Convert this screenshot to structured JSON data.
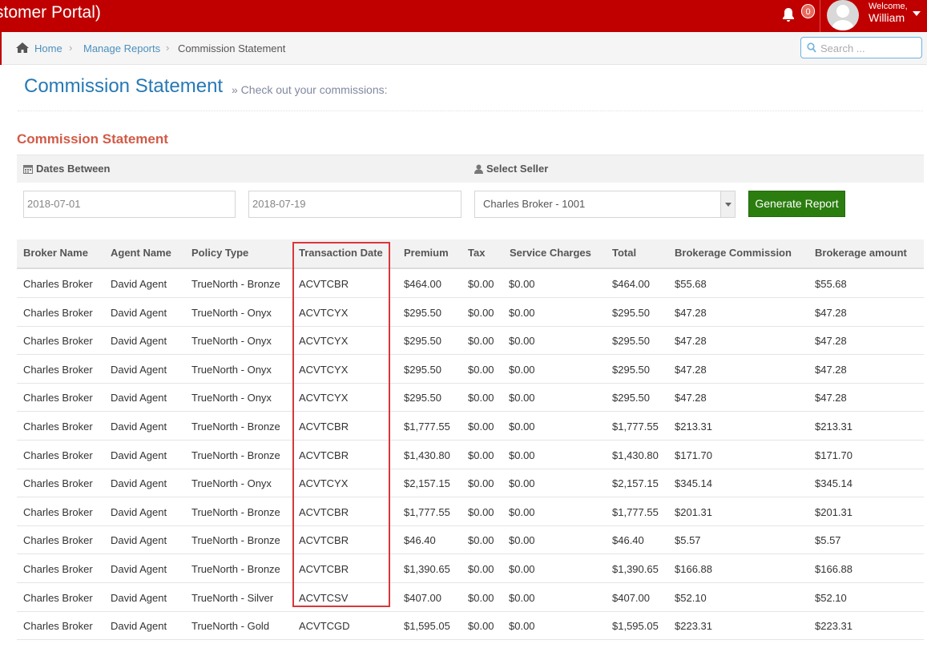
{
  "app": {
    "title": "stomer Portal)"
  },
  "header": {
    "notification_count": "0",
    "welcome": "Welcome,",
    "user_name": "William"
  },
  "breadcrumb": {
    "home": "Home",
    "manage_reports": "Manage Reports",
    "current": "Commission Statement"
  },
  "search": {
    "placeholder": "Search ..."
  },
  "page": {
    "title": "Commission Statement",
    "subtitle": "» Check out your commissions:"
  },
  "section": {
    "title": "Commission Statement"
  },
  "filters": {
    "dates_label": "Dates Between",
    "seller_label": "Select Seller",
    "date_from": "2018-07-01",
    "date_to": "2018-07-19",
    "seller_selected": "Charles Broker - 1001",
    "generate_label": "Generate Report"
  },
  "table": {
    "columns": [
      "Broker Name",
      "Agent Name",
      "Policy Type",
      "Transaction Date",
      "Premium",
      "Tax",
      "Service Charges",
      "Total",
      "Brokerage Commission",
      "Brokerage amount"
    ],
    "rows": [
      [
        "Charles Broker",
        "David Agent",
        "TrueNorth - Bronze",
        "ACVTCBR",
        "$464.00",
        "$0.00",
        "$0.00",
        "$464.00",
        "$55.68",
        "$55.68"
      ],
      [
        "Charles Broker",
        "David Agent",
        "TrueNorth - Onyx",
        "ACVTCYX",
        "$295.50",
        "$0.00",
        "$0.00",
        "$295.50",
        "$47.28",
        "$47.28"
      ],
      [
        "Charles Broker",
        "David Agent",
        "TrueNorth - Onyx",
        "ACVTCYX",
        "$295.50",
        "$0.00",
        "$0.00",
        "$295.50",
        "$47.28",
        "$47.28"
      ],
      [
        "Charles Broker",
        "David Agent",
        "TrueNorth - Onyx",
        "ACVTCYX",
        "$295.50",
        "$0.00",
        "$0.00",
        "$295.50",
        "$47.28",
        "$47.28"
      ],
      [
        "Charles Broker",
        "David Agent",
        "TrueNorth - Onyx",
        "ACVTCYX",
        "$295.50",
        "$0.00",
        "$0.00",
        "$295.50",
        "$47.28",
        "$47.28"
      ],
      [
        "Charles Broker",
        "David Agent",
        "TrueNorth - Bronze",
        "ACVTCBR",
        "$1,777.55",
        "$0.00",
        "$0.00",
        "$1,777.55",
        "$213.31",
        "$213.31"
      ],
      [
        "Charles Broker",
        "David Agent",
        "TrueNorth - Bronze",
        "ACVTCBR",
        "$1,430.80",
        "$0.00",
        "$0.00",
        "$1,430.80",
        "$171.70",
        "$171.70"
      ],
      [
        "Charles Broker",
        "David Agent",
        "TrueNorth - Onyx",
        "ACVTCYX",
        "$2,157.15",
        "$0.00",
        "$0.00",
        "$2,157.15",
        "$345.14",
        "$345.14"
      ],
      [
        "Charles Broker",
        "David Agent",
        "TrueNorth - Bronze",
        "ACVTCBR",
        "$1,777.55",
        "$0.00",
        "$0.00",
        "$1,777.55",
        "$201.31",
        "$201.31"
      ],
      [
        "Charles Broker",
        "David Agent",
        "TrueNorth - Bronze",
        "ACVTCBR",
        "$46.40",
        "$0.00",
        "$0.00",
        "$46.40",
        "$5.57",
        "$5.57"
      ],
      [
        "Charles Broker",
        "David Agent",
        "TrueNorth - Bronze",
        "ACVTCBR",
        "$1,390.65",
        "$0.00",
        "$0.00",
        "$1,390.65",
        "$166.88",
        "$166.88"
      ],
      [
        "Charles Broker",
        "David Agent",
        "TrueNorth - Silver",
        "ACVTCSV",
        "$407.00",
        "$0.00",
        "$0.00",
        "$407.00",
        "$52.10",
        "$52.10"
      ],
      [
        "Charles Broker",
        "David Agent",
        "TrueNorth - Gold",
        "ACVTCGD",
        "$1,595.05",
        "$0.00",
        "$0.00",
        "$1,595.05",
        "$223.31",
        "$223.31"
      ]
    ]
  },
  "colors": {
    "topbar": "#c00000",
    "link": "#4c8fbd",
    "title": "#2679b5",
    "section_title": "#d15b47",
    "button": "#2b7d0f",
    "highlight": "#d9373b"
  },
  "icons": [
    "bell-icon",
    "avatar-icon",
    "caret-down-icon",
    "home-icon",
    "search-icon",
    "calendar-icon",
    "user-icon",
    "chevron-down-icon"
  ]
}
